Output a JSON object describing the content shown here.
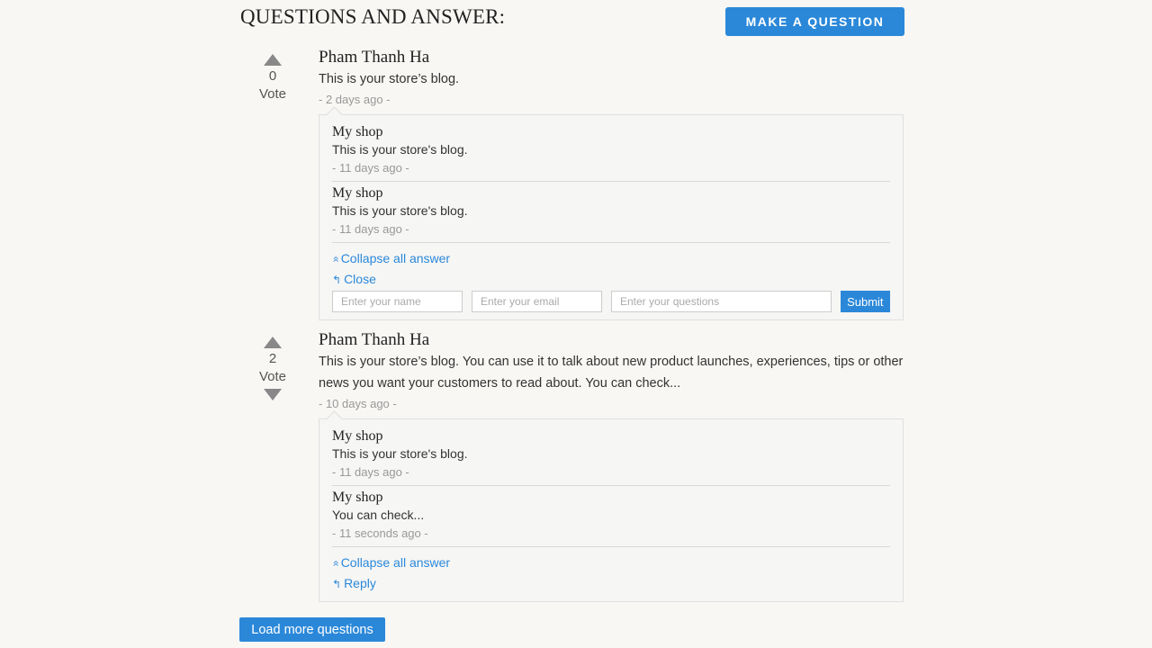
{
  "header": {
    "title": "QUESTIONS AND ANSWER:",
    "make_question_label": "MAKE A QUESTION"
  },
  "questions": [
    {
      "votes": "0",
      "vote_label": "Vote",
      "author": "Pham Thanh Ha",
      "text": "This is your store’s blog.",
      "time": "- 2 days ago -",
      "answers": [
        {
          "author": "My shop",
          "text": "This is your store's blog.",
          "time": "- 11 days ago -"
        },
        {
          "author": "My shop",
          "text": "This is your store's blog.",
          "time": "- 11 days ago -"
        }
      ],
      "collapse_label": "Collapse all answer",
      "close_label": "Close",
      "form": {
        "name_placeholder": "Enter your name",
        "email_placeholder": "Enter your email",
        "question_placeholder": "Enter your questions",
        "submit_label": "Submit"
      }
    },
    {
      "votes": "2",
      "vote_label": "Vote",
      "author": "Pham Thanh Ha",
      "text": "This is your store’s blog. You can use it to talk about new product launches, experiences, tips or other news you want your customers to read about. You can check...",
      "time": "- 10 days ago -",
      "answers": [
        {
          "author": "My shop",
          "text": "This is your store's blog.",
          "time": "- 11 days ago -"
        },
        {
          "author": "My shop",
          "text": "You can check...",
          "time": "- 11 seconds ago -"
        }
      ],
      "collapse_label": "Collapse all answer",
      "reply_label": "Reply"
    }
  ],
  "footer": {
    "load_more_label": "Load more questions"
  },
  "icons": {
    "collapse": "double-chevron-up-icon",
    "reply": "reply-arrow-icon",
    "vote_up": "triangle-up-icon",
    "vote_down": "triangle-down-icon"
  },
  "colors": {
    "accent": "#2b88d9",
    "background": "#f8f7f4"
  }
}
